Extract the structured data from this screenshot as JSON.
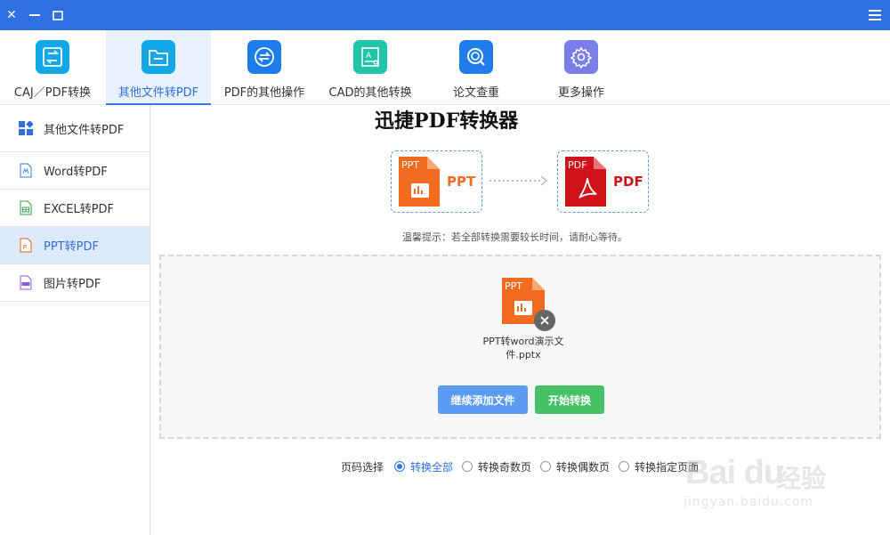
{
  "window": {
    "close_glyph": "✕",
    "menu_icon": "menu-icon"
  },
  "toolbar": {
    "items": [
      {
        "label": "CAJ／PDF转换",
        "color": "#12a8e8"
      },
      {
        "label": "其他文件转PDF",
        "color": "#12a8e8"
      },
      {
        "label": "PDF的其他操作",
        "color": "#1e7de8"
      },
      {
        "label": "CAD的其他转换",
        "color": "#20c4a6"
      },
      {
        "label": "论文查重",
        "color": "#1e7de8"
      },
      {
        "label": "更多操作",
        "color": "#7b7de8"
      }
    ],
    "active_index": 1
  },
  "sidebar": {
    "items": [
      {
        "label": "其他文件转PDF",
        "icon": "grid-icon"
      },
      {
        "label": "Word转PDF",
        "icon": "word-file-icon"
      },
      {
        "label": "EXCEL转PDF",
        "icon": "excel-file-icon"
      },
      {
        "label": "PPT转PDF",
        "icon": "ppt-file-icon"
      },
      {
        "label": "图片转PDF",
        "icon": "image-file-icon"
      }
    ],
    "active_index": 3
  },
  "main": {
    "title": "迅捷PDF转换器",
    "source": {
      "badge": "PPT",
      "label": "PPT",
      "color": "#f26b21"
    },
    "target": {
      "badge": "PDF",
      "label": "PDF",
      "color": "#d0121b"
    },
    "hint": "温馨提示：若全部转换需要较长时间，请耐心等待。",
    "file": {
      "badge": "PPT",
      "name": "PPT转word演示文件.pptx"
    },
    "buttons": {
      "add": "继续添加文件",
      "start": "开始转换"
    },
    "page_select": {
      "label": "页码选择",
      "options": [
        "转换全部",
        "转换奇数页",
        "转换偶数页",
        "转换指定页面"
      ],
      "selected_index": 0
    }
  },
  "watermark": {
    "brand": "Bai du",
    "cn": "经验",
    "url": "jingyan.baidu.com"
  },
  "colors": {
    "titlebar": "#2f6fe0",
    "accent": "#3478e6",
    "add_button": "#5b9cf3",
    "start_button": "#46c165"
  }
}
